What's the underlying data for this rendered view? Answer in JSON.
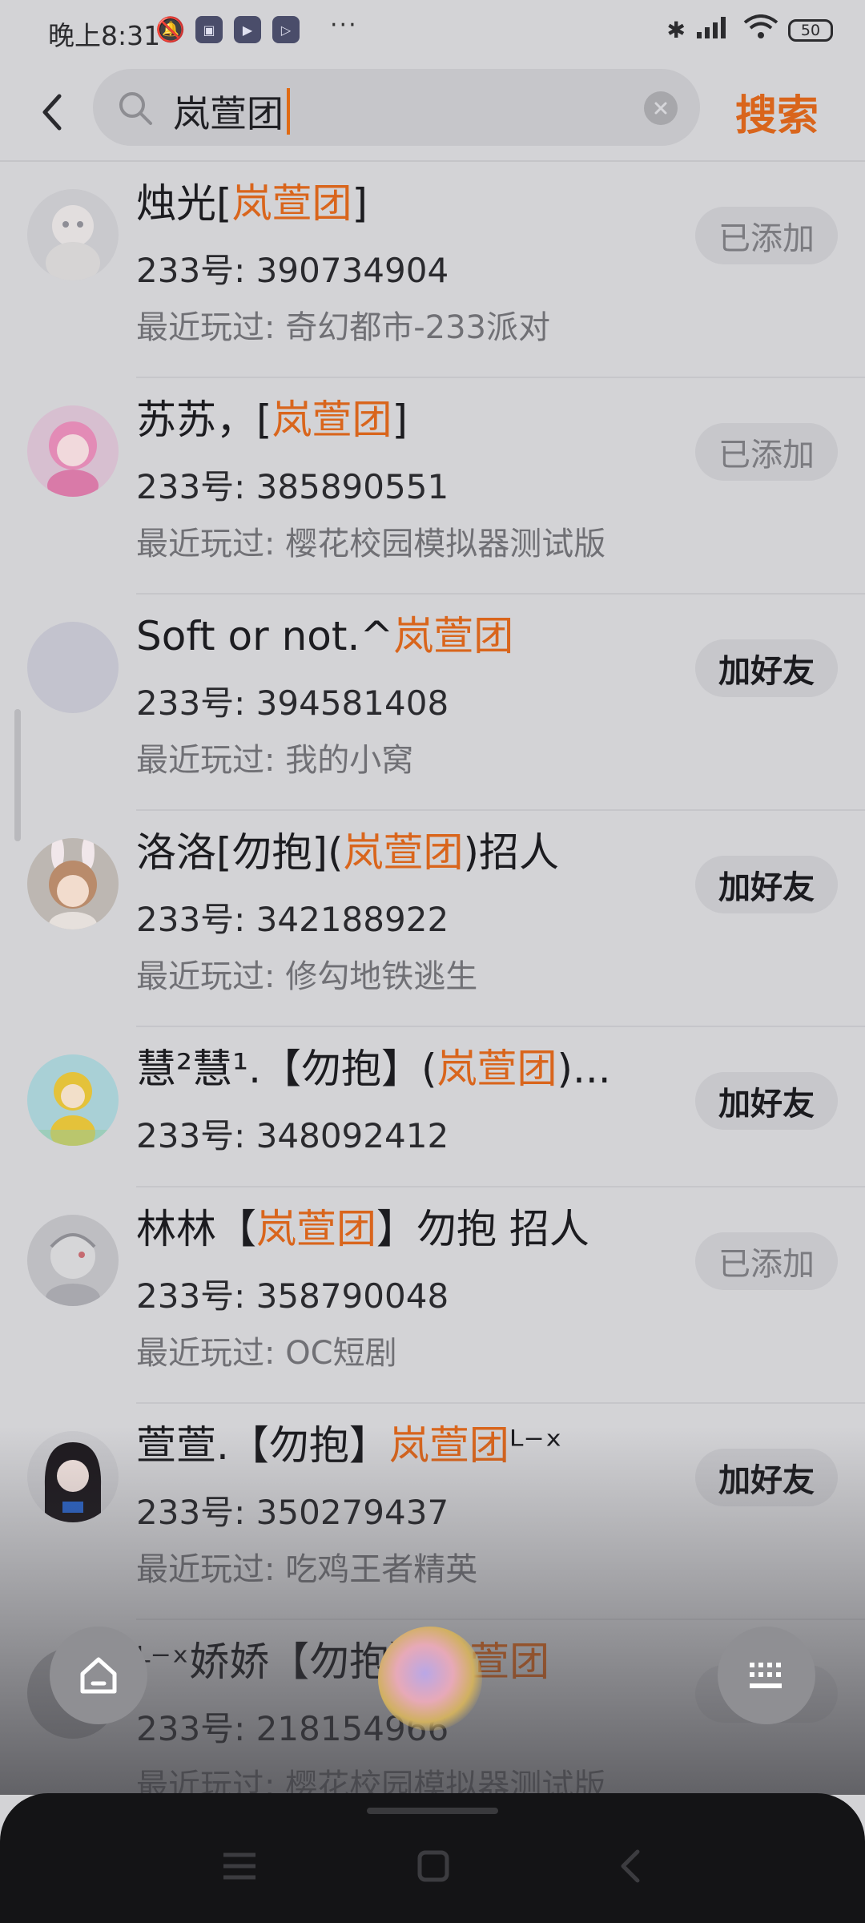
{
  "status_bar": {
    "time": "晚上8:31",
    "more": "···",
    "battery": "50"
  },
  "header": {
    "query": "岚萱团",
    "search_button": "搜索"
  },
  "results": [
    {
      "name_pre": "烛光[",
      "name_hl": "岚萱团",
      "name_post": "]",
      "uid": "233号: 390734904",
      "played": "最近玩过: 奇幻都市-233派对",
      "button": "已添加",
      "state": "added",
      "avatar": "avatar-white-figure"
    },
    {
      "name_pre": "苏苏，[",
      "name_hl": "岚萱团",
      "name_post": "]",
      "uid": "233号: 385890551",
      "played": "最近玩过: 樱花校园模拟器测试版",
      "button": "已添加",
      "state": "added",
      "avatar": "avatar-pink-hair"
    },
    {
      "name_pre": "Soft or not.^",
      "name_hl": "岚萱团",
      "name_post": "",
      "uid": "233号: 394581408",
      "played": "最近玩过: 我的小窝",
      "button": "加好友",
      "state": "add",
      "avatar": "avatar-blank"
    },
    {
      "name_pre": "洛洛[勿抱](",
      "name_hl": "岚萱团",
      "name_post": ")招人",
      "uid": "233号: 342188922",
      "played": "最近玩过: 修勾地铁逃生",
      "button": "加好友",
      "state": "add",
      "avatar": "avatar-bunny-ears"
    },
    {
      "name_pre": "慧²慧¹.【勿抱】(",
      "name_hl": "岚萱团",
      "name_post": ")...",
      "uid": "233号: 348092412",
      "played": "",
      "button": "加好友",
      "state": "add",
      "avatar": "avatar-yellow-raincoat"
    },
    {
      "name_pre": "林林【",
      "name_hl": "岚萱团",
      "name_post": "】勿抱 招人",
      "uid": "233号: 358790048",
      "played": "最近玩过: OC短剧",
      "button": "已添加",
      "state": "added",
      "avatar": "avatar-grey-sketch"
    },
    {
      "name_pre": "萱萱.【勿抱】",
      "name_hl": "岚萱团",
      "name_post": "ᴸ⁻ˣ",
      "uid": "233号: 350279437",
      "played": "最近玩过: 吃鸡王者精英",
      "button": "加好友",
      "state": "add",
      "avatar": "avatar-dark-hair-girl"
    },
    {
      "name_pre": "ᴸ⁻ˣ娇娇【勿抱】",
      "name_hl": "岚萱团",
      "name_post": "",
      "uid": "233号: 218154966",
      "played": "最近玩过: 樱花校园模拟器测试版",
      "button": "",
      "state": "added",
      "avatar": "avatar-partial"
    }
  ],
  "icons": {
    "back": "chevron-left-icon",
    "search": "magnifier-icon",
    "clear": "clear-x-icon",
    "home": "home-icon",
    "keyboard": "keyboard-icon"
  }
}
